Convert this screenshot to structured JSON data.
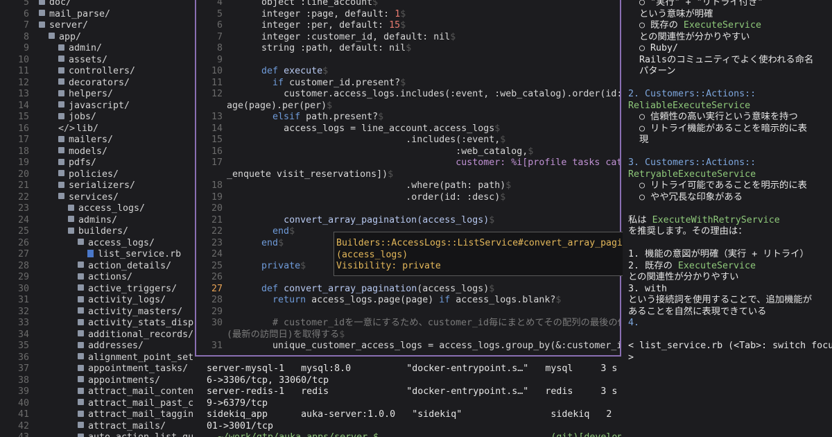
{
  "tree": {
    "items": [
      {
        "ln": "5",
        "indent": 1,
        "type": "folder",
        "label": "doc/"
      },
      {
        "ln": "6",
        "indent": 1,
        "type": "folder",
        "label": "mail_parse/"
      },
      {
        "ln": "7",
        "indent": 1,
        "type": "folder",
        "label": "server/"
      },
      {
        "ln": "8",
        "indent": 2,
        "type": "folder",
        "label": "app/"
      },
      {
        "ln": "9",
        "indent": 3,
        "type": "folder",
        "label": "admin/"
      },
      {
        "ln": "10",
        "indent": 3,
        "type": "folder",
        "label": "assets/"
      },
      {
        "ln": "11",
        "indent": 3,
        "type": "folder",
        "label": "controllers/"
      },
      {
        "ln": "12",
        "indent": 3,
        "type": "folder",
        "label": "decorators/"
      },
      {
        "ln": "13",
        "indent": 3,
        "type": "folder",
        "label": "helpers/"
      },
      {
        "ln": "14",
        "indent": 3,
        "type": "folder",
        "label": "javascript/"
      },
      {
        "ln": "15",
        "indent": 3,
        "type": "folder",
        "label": "jobs/"
      },
      {
        "ln": "16",
        "indent": 3,
        "type": "lib",
        "label": "lib/"
      },
      {
        "ln": "17",
        "indent": 3,
        "type": "folder",
        "label": "mailers/"
      },
      {
        "ln": "18",
        "indent": 3,
        "type": "folder",
        "label": "models/"
      },
      {
        "ln": "19",
        "indent": 3,
        "type": "folder",
        "label": "pdfs/"
      },
      {
        "ln": "20",
        "indent": 3,
        "type": "folder",
        "label": "policies/"
      },
      {
        "ln": "21",
        "indent": 3,
        "type": "folder",
        "label": "serializers/"
      },
      {
        "ln": "22",
        "indent": 3,
        "type": "folder",
        "label": "services/"
      },
      {
        "ln": "23",
        "indent": 4,
        "type": "folder",
        "label": "access_logs/"
      },
      {
        "ln": "24",
        "indent": 4,
        "type": "folder",
        "label": "admins/"
      },
      {
        "ln": "25",
        "indent": 4,
        "type": "folder",
        "label": "builders/"
      },
      {
        "ln": "26",
        "indent": 5,
        "type": "folder",
        "label": "access_logs/"
      },
      {
        "ln": "27",
        "indent": 6,
        "type": "file",
        "label": "list_service.rb"
      },
      {
        "ln": "28",
        "indent": 5,
        "type": "folder",
        "label": "action_details/"
      },
      {
        "ln": "29",
        "indent": 5,
        "type": "folder",
        "label": "actions/"
      },
      {
        "ln": "30",
        "indent": 5,
        "type": "folder",
        "label": "active_triggers/"
      },
      {
        "ln": "31",
        "indent": 5,
        "type": "folder",
        "label": "activity_logs/"
      },
      {
        "ln": "32",
        "indent": 5,
        "type": "folder",
        "label": "activity_masters/"
      },
      {
        "ln": "33",
        "indent": 5,
        "type": "folder",
        "label": "activity_stats_disp"
      },
      {
        "ln": "34",
        "indent": 5,
        "type": "folder",
        "label": "additional_records/"
      },
      {
        "ln": "35",
        "indent": 5,
        "type": "folder",
        "label": "addresses/"
      },
      {
        "ln": "36",
        "indent": 5,
        "type": "folder",
        "label": "alignment_point_set"
      },
      {
        "ln": "37",
        "indent": 5,
        "type": "folder",
        "label": "appointment_tasks/"
      },
      {
        "ln": "38",
        "indent": 5,
        "type": "folder",
        "label": "appointments/"
      },
      {
        "ln": "39",
        "indent": 5,
        "type": "folder",
        "label": "attract_mail_conten"
      },
      {
        "ln": "40",
        "indent": 5,
        "type": "folder",
        "label": "attract_mail_past_c"
      },
      {
        "ln": "41",
        "indent": 5,
        "type": "folder",
        "label": "attract_mail_taggin"
      },
      {
        "ln": "42",
        "indent": 5,
        "type": "folder",
        "label": "attract_mails/"
      },
      {
        "ln": "43",
        "indent": 5,
        "type": "folder",
        "label": "auto_action_list_gu"
      }
    ]
  },
  "editor": {
    "lines": [
      {
        "ln": "4",
        "segs": [
          [
            "      ",
            ""
          ],
          [
            "object :line_account",
            "sym"
          ],
          [
            "$",
            "dollar"
          ]
        ]
      },
      {
        "ln": "5",
        "segs": [
          [
            "      ",
            ""
          ],
          [
            "integer :page, default: ",
            "sym"
          ],
          [
            "1",
            "num"
          ],
          [
            "$",
            "dollar"
          ]
        ]
      },
      {
        "ln": "6",
        "segs": [
          [
            "      ",
            ""
          ],
          [
            "integer :per, default: ",
            "sym"
          ],
          [
            "15",
            "num"
          ],
          [
            "$",
            "dollar"
          ]
        ]
      },
      {
        "ln": "7",
        "segs": [
          [
            "      ",
            ""
          ],
          [
            "integer :customer_id, default: nil",
            "sym"
          ],
          [
            "$",
            "dollar"
          ]
        ]
      },
      {
        "ln": "8",
        "segs": [
          [
            "      ",
            ""
          ],
          [
            "string :path, default: nil",
            "sym"
          ],
          [
            "$",
            "dollar"
          ]
        ]
      },
      {
        "ln": "9",
        "segs": []
      },
      {
        "ln": "10",
        "segs": [
          [
            "      ",
            ""
          ],
          [
            "def ",
            "kw"
          ],
          [
            "execute",
            "fn"
          ],
          [
            "$",
            "dollar"
          ]
        ]
      },
      {
        "ln": "11",
        "segs": [
          [
            "        ",
            ""
          ],
          [
            "if ",
            "kw"
          ],
          [
            "customer_id.present?",
            "sym"
          ],
          [
            "$",
            "dollar"
          ]
        ]
      },
      {
        "ln": "12",
        "segs": [
          [
            "          ",
            ""
          ],
          [
            "customer.access_logs.includes(:event, :web_catalog).order(id: :desc).p",
            "sym"
          ]
        ]
      },
      {
        "ln": "",
        "segs": [
          [
            "age(page).per(per)",
            "sym"
          ],
          [
            "$",
            "dollar"
          ]
        ]
      },
      {
        "ln": "13",
        "segs": [
          [
            "        ",
            ""
          ],
          [
            "elsif ",
            "kw"
          ],
          [
            "path.present?",
            "sym"
          ],
          [
            "$",
            "dollar"
          ]
        ]
      },
      {
        "ln": "14",
        "segs": [
          [
            "          ",
            ""
          ],
          [
            "access_logs = line_account.access_logs",
            "sym"
          ],
          [
            "$",
            "dollar"
          ]
        ]
      },
      {
        "ln": "15",
        "segs": [
          [
            "                                ",
            ""
          ],
          [
            ".includes(:event,",
            "sym"
          ],
          [
            "$",
            "dollar"
          ]
        ]
      },
      {
        "ln": "16",
        "segs": [
          [
            "                                         ",
            ""
          ],
          [
            ":web_catalog,",
            "sym"
          ],
          [
            "$",
            "dollar"
          ]
        ]
      },
      {
        "ln": "17",
        "segs": [
          [
            "                                         ",
            ""
          ],
          [
            "customer: %i[profile tasks catalog",
            "purple"
          ]
        ]
      },
      {
        "ln": "",
        "segs": [
          [
            "_enquete visit_reservations])",
            "sym"
          ],
          [
            "$",
            "dollar"
          ]
        ]
      },
      {
        "ln": "18",
        "segs": [
          [
            "                                ",
            ""
          ],
          [
            ".where(path: path)",
            "sym"
          ],
          [
            "$",
            "dollar"
          ]
        ]
      },
      {
        "ln": "19",
        "segs": [
          [
            "                                ",
            ""
          ],
          [
            ".order(id: :desc)",
            "sym"
          ],
          [
            "$",
            "dollar"
          ]
        ]
      },
      {
        "ln": "20",
        "segs": []
      },
      {
        "ln": "21",
        "segs": [
          [
            "          ",
            ""
          ],
          [
            "convert_array_pagination(access_logs)",
            "fn"
          ],
          [
            "$",
            "dollar"
          ]
        ]
      },
      {
        "ln": "22",
        "segs": [
          [
            "        ",
            ""
          ],
          [
            "end",
            "kw"
          ],
          [
            "$",
            "dollar"
          ]
        ]
      },
      {
        "ln": "23",
        "segs": [
          [
            "      ",
            ""
          ],
          [
            "end",
            "kw"
          ],
          [
            "$",
            "dollar"
          ]
        ]
      },
      {
        "ln": "24",
        "segs": []
      },
      {
        "ln": "25",
        "segs": [
          [
            "      ",
            ""
          ],
          [
            "private",
            "kw"
          ],
          [
            "$",
            "dollar"
          ]
        ]
      },
      {
        "ln": "26",
        "segs": []
      },
      {
        "ln": "27",
        "cur": true,
        "segs": [
          [
            "      ",
            ""
          ],
          [
            "def ",
            "kw"
          ],
          [
            "convert_array_pagination",
            "fn"
          ],
          [
            "(access_logs)",
            "sym"
          ],
          [
            "$",
            "dollar"
          ]
        ]
      },
      {
        "ln": "28",
        "segs": [
          [
            "        ",
            ""
          ],
          [
            "return ",
            "kw"
          ],
          [
            "access_logs.page(page) ",
            "sym"
          ],
          [
            "if ",
            "kw"
          ],
          [
            "access_logs.blank?",
            "sym"
          ],
          [
            "$",
            "dollar"
          ]
        ]
      },
      {
        "ln": "29",
        "segs": []
      },
      {
        "ln": "30",
        "segs": [
          [
            "        ",
            ""
          ],
          [
            "# customer_idを一意にするため、customer_id毎にまとめてその配列の最後の値",
            "cm"
          ]
        ]
      },
      {
        "ln": "",
        "segs": [
          [
            "(最新の訪問日)を取得する",
            "cm"
          ],
          [
            "$",
            "dollar"
          ]
        ]
      },
      {
        "ln": "31",
        "segs": [
          [
            "        ",
            ""
          ],
          [
            "unique_customer_access_logs = access_logs.group_by(&:customer_id)",
            "sym"
          ],
          [
            "$",
            "dollar"
          ]
        ]
      }
    ]
  },
  "tooltip": {
    "line1": "Builders::AccessLogs::ListService#convert_array_pagination",
    "line2": "(access_logs)",
    "line3": "Visibility: private"
  },
  "terminal": {
    "lines": [
      "server-mysql-1   mysql:8.0          \"docker-entrypoint.s…\"   mysql     3 s",
      "6->3306/tcp, 33060/tcp",
      "server-redis-1   redis              \"docker-entrypoint.s…\"   redis     3 s",
      "9->6379/tcp",
      "sidekiq_app      auka-server:1.0.0   \"sidekiq\"                sidekiq   2",
      "01->3001/tcp",
      "  ~/work/gtp/auka_apps/server $                               (git)[develop"
    ]
  },
  "chat": {
    "lines": [
      {
        "text": "  ○ \"実行\" + \"リトライ付き\"",
        "cls": ""
      },
      {
        "text": "  という意味が明確",
        "cls": ""
      },
      {
        "text": "  ○ 既存の ",
        "cls": "",
        "tail": "ExecuteService",
        "tailcls": "green"
      },
      {
        "text": "  との関連性が分かりやすい",
        "cls": ""
      },
      {
        "text": "  ○ Ruby/",
        "cls": ""
      },
      {
        "text": "  Railsのコミュニティでよく使われる命名",
        "cls": ""
      },
      {
        "text": "  パターン",
        "cls": ""
      },
      {
        "text": "",
        "cls": ""
      },
      {
        "text": "2. Customers::Actions::",
        "cls": "blue"
      },
      {
        "text": "ReliableExecuteService",
        "cls": "green"
      },
      {
        "text": "  ○ 信頼性の高い実行という意味を持つ",
        "cls": ""
      },
      {
        "text": "  ○ リトライ機能があることを暗示的に表",
        "cls": ""
      },
      {
        "text": "  現",
        "cls": ""
      },
      {
        "text": "",
        "cls": ""
      },
      {
        "text": "3. Customers::Actions::",
        "cls": "blue"
      },
      {
        "text": "RetryableExecuteService",
        "cls": "green"
      },
      {
        "text": "  ○ リトライ可能であることを明示的に表",
        "cls": ""
      },
      {
        "text": "  ○ やや冗長な印象がある",
        "cls": ""
      },
      {
        "text": "",
        "cls": ""
      },
      {
        "text": "私は ",
        "cls": "",
        "tail": "ExecuteWithRetryService",
        "tailcls": "green"
      },
      {
        "text": "を推奨します。その理由は：",
        "cls": ""
      },
      {
        "text": "",
        "cls": ""
      },
      {
        "text": "1. 機能の意図が明確（実行 + リトライ）",
        "cls": "",
        "numcls": "blue"
      },
      {
        "text": "2. 既存の ",
        "cls": "",
        "tail": "ExecuteService",
        "tailcls": "green"
      },
      {
        "text": "との関連性が分かりやすい",
        "cls": ""
      },
      {
        "text": "3. with",
        "cls": "",
        "numcls": "green"
      },
      {
        "text": "という接続詞を使用することで、追加機能が",
        "cls": ""
      },
      {
        "text": "あることを自然に表現できている",
        "cls": ""
      },
      {
        "text": "4.                                    @@@",
        "cls": "blue"
      },
      {
        "text": "",
        "cls": ""
      },
      {
        "text": "< list_service.rb (<Tab>: switch focus)",
        "cls": ""
      },
      {
        "text": ">",
        "cls": ""
      }
    ]
  }
}
